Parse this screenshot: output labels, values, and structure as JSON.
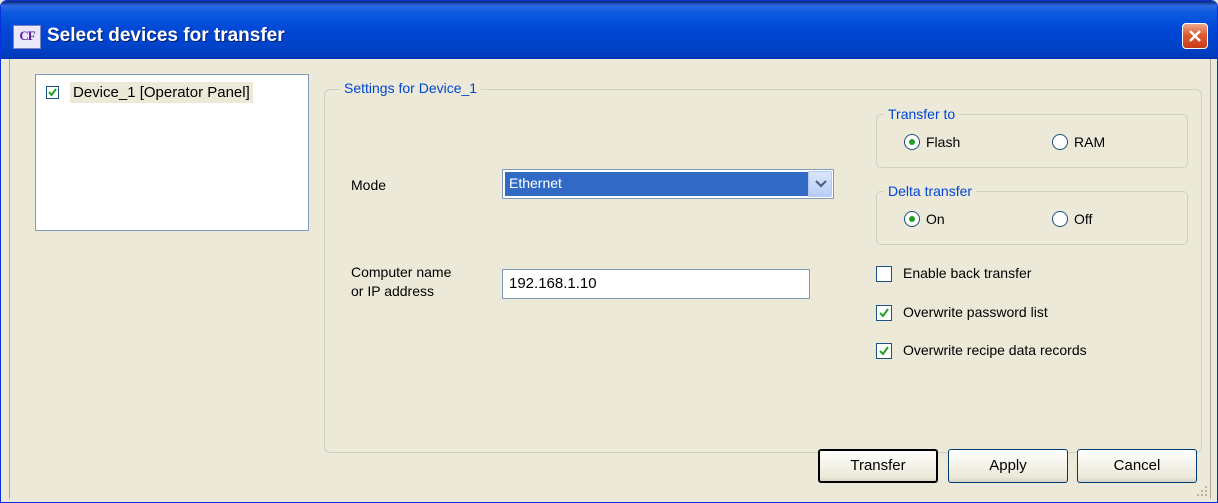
{
  "window": {
    "title": "Select devices for transfer",
    "icon_text": "CF"
  },
  "device_list": {
    "items": [
      {
        "label": "Device_1 [Operator Panel]",
        "checked": true
      }
    ]
  },
  "settings": {
    "legend": "Settings for Device_1",
    "mode_label": "Mode",
    "mode_value": "Ethernet",
    "address_label_line1": "Computer name",
    "address_label_line2": "or IP address",
    "address_value": "192.168.1.10",
    "transfer_to": {
      "legend": "Transfer to",
      "options": [
        {
          "label": "Flash",
          "selected": true
        },
        {
          "label": "RAM",
          "selected": false
        }
      ]
    },
    "delta_transfer": {
      "legend": "Delta transfer",
      "options": [
        {
          "label": "On",
          "selected": true
        },
        {
          "label": "Off",
          "selected": false
        }
      ]
    },
    "checkboxes": [
      {
        "label": "Enable back transfer",
        "checked": false
      },
      {
        "label": "Overwrite password list",
        "checked": true
      },
      {
        "label": "Overwrite recipe data records",
        "checked": true
      }
    ]
  },
  "buttons": {
    "transfer": "Transfer",
    "apply": "Apply",
    "cancel": "Cancel"
  },
  "colors": {
    "accent": "#0046d5",
    "selection": "#316ac5",
    "check": "#21a121"
  }
}
